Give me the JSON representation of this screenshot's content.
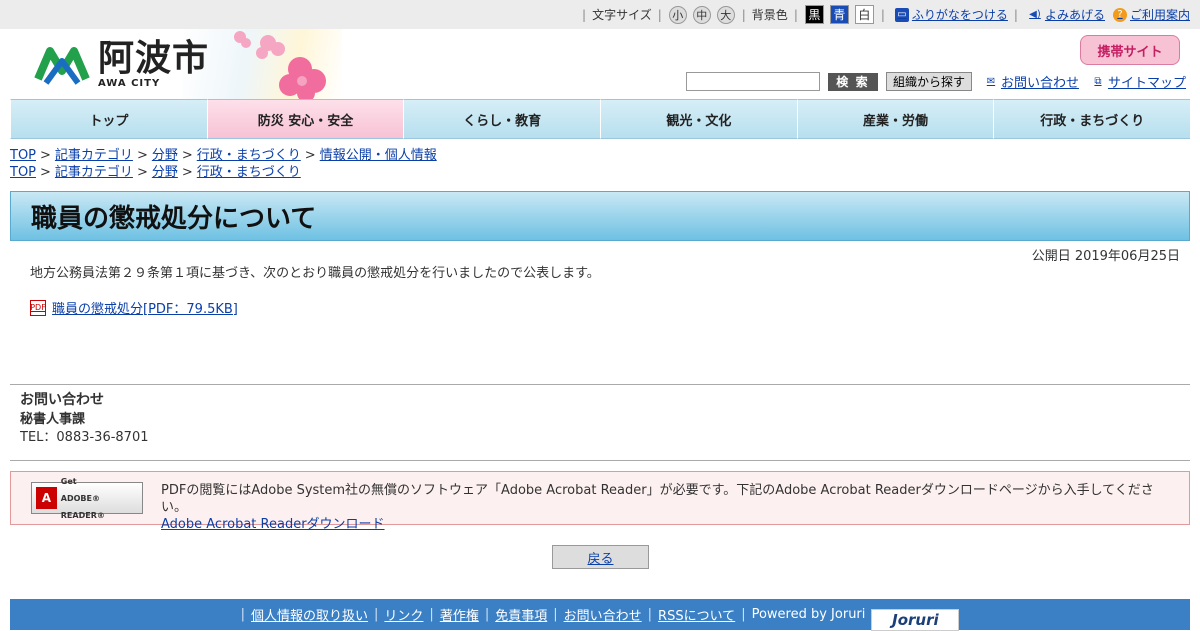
{
  "topbar": {
    "font_size_label": "文字サイズ",
    "font_sizes": [
      "小",
      "中",
      "大"
    ],
    "bg_label": "背景色",
    "bg_colors": [
      "黒",
      "青",
      "白"
    ],
    "furigana": "ふりがなをつける",
    "yomiageru": "よみあげる",
    "guide": "ご利用案内"
  },
  "header": {
    "logo_jp": "阿波市",
    "logo_en": "AWA CITY",
    "mobile_site": "携帯サイト",
    "search_button": "検 索",
    "org_button": "組織から探す",
    "contact_link": "お問い合わせ",
    "sitemap_link": "サイトマップ"
  },
  "nav": [
    "トップ",
    "防災 安心・安全",
    "くらし・教育",
    "観光・文化",
    "産業・労働",
    "行政・まちづくり"
  ],
  "breadcrumbs": [
    [
      "TOP",
      "記事カテゴリ",
      "分野",
      "行政・まちづくり",
      "情報公開・個人情報"
    ],
    [
      "TOP",
      "記事カテゴリ",
      "分野",
      "行政・まちづくり"
    ]
  ],
  "article": {
    "title": "職員の懲戒処分について",
    "published": "公開日 2019年06月25日",
    "body": "地方公務員法第２９条第１項に基づき、次のとおり職員の懲戒処分を行いましたので公表します。",
    "pdf_link": "職員の懲戒処分[PDF：79.5KB]"
  },
  "contact": {
    "heading": "お問い合わせ",
    "dept": "秘書人事課",
    "tel": "TEL：0883-36-8701"
  },
  "adobe": {
    "badge_top": "Get",
    "badge_bottom": "ADOBE® READER®",
    "text": "PDFの閲覧にはAdobe System社の無償のソフトウェア「Adobe Acrobat Reader」が必要です。下記のAdobe Acrobat Readerダウンロードページから入手してください。",
    "link": "Adobe Acrobat Readerダウンロード"
  },
  "back_button": "戻る",
  "footer": {
    "links": [
      "個人情報の取り扱い",
      "リンク",
      "著作権",
      "免責事項",
      "お問い合わせ",
      "RSSについて"
    ],
    "powered": "Powered by Joruri",
    "joruri": "Joruri"
  },
  "colors": {
    "nav_active": "#f8c2d5",
    "nav": "#b7dfee",
    "footer": "#3b7fc4",
    "link": "#0b3fa8"
  }
}
